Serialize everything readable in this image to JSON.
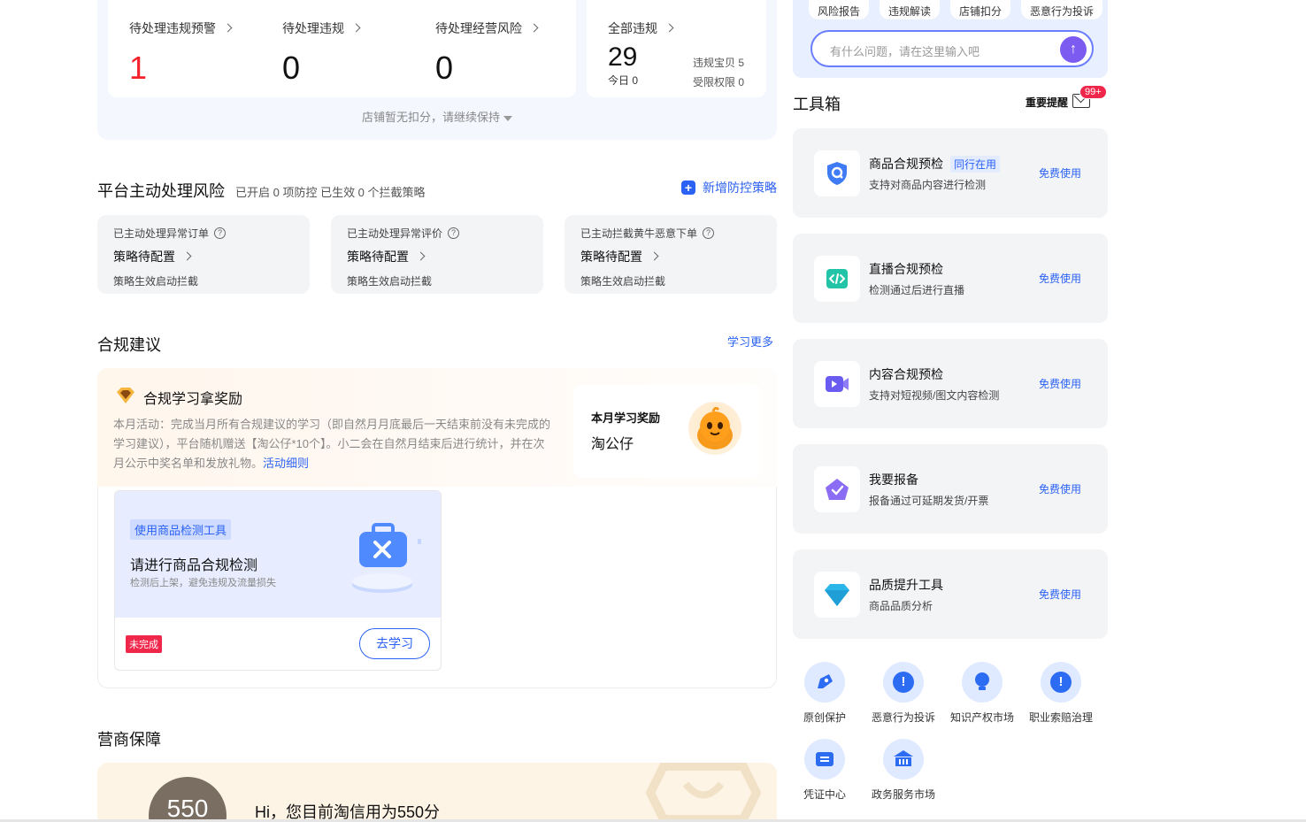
{
  "violations": {
    "items": [
      {
        "label": "待处理违规预警",
        "value": "1",
        "color": "#f5222d"
      },
      {
        "label": "待处理违规",
        "value": "0",
        "color": "#111111"
      },
      {
        "label": "待处理经营风险",
        "value": "0",
        "color": "#111111"
      }
    ],
    "all": {
      "label": "全部违规",
      "value": "29",
      "today": "今日 0",
      "baby": "违规宝贝 5",
      "restricted": "受限权限 0"
    },
    "deduct_note": "店铺暂无扣分，请继续保持"
  },
  "platform": {
    "title": "平台主动处理风险",
    "subtitle": "已开启 0 项防控 已生效 0 个拦截策略",
    "add_label": "新增防控策略",
    "cards": [
      {
        "label": "已主动处理异常订单",
        "status": "策略待配置",
        "note": "策略生效启动拦截"
      },
      {
        "label": "已主动处理异常评价",
        "status": "策略待配置",
        "note": "策略生效启动拦截"
      },
      {
        "label": "已主动拦截黄牛恶意下单",
        "status": "策略待配置",
        "note": "策略生效启动拦截"
      }
    ]
  },
  "compliance": {
    "title": "合规建议",
    "learn_more": "学习更多",
    "reward_title": "合规学习拿奖励",
    "reward_desc": "本月活动：完成当月所有合规建议的学习（即自然月月底最后一天结束前没有未完成的学习建议），平台随机赠送【淘公仔*10个】。小二会在自然月结束后进行统计，并在次月公示中奖名单和发放礼物。",
    "reward_link": "活动细则",
    "month_reward_label": "本月学习奖励",
    "month_reward_value": "淘公仔",
    "task": {
      "tag": "使用商品检测工具",
      "title": "请进行商品合规检测",
      "subtitle": "检测后上架，避免违规及流量损失",
      "status": "未完成",
      "button": "去学习"
    }
  },
  "business": {
    "title": "营商保障",
    "credit_score": "550",
    "credit_text": "Hi，您目前淘信用为550分"
  },
  "assistant": {
    "chips": [
      "风险报告",
      "违规解读",
      "店铺扣分",
      "恶意行为投诉"
    ],
    "input_placeholder": "有什么问题，请在这里输入吧"
  },
  "toolbox": {
    "title": "工具箱",
    "reminder": "重要提醒",
    "badge": "99+",
    "tools": [
      {
        "name": "商品合规预检",
        "tag": "同行在用",
        "desc": "支持对商品内容进行检测",
        "action": "免费使用",
        "icon": "shield-search-icon",
        "color": "#3f7bf5"
      },
      {
        "name": "直播合规预检",
        "tag": "",
        "desc": "检测通过后进行直播",
        "action": "免费使用",
        "icon": "code-icon",
        "color": "#21c4a6"
      },
      {
        "name": "内容合规预检",
        "tag": "",
        "desc": "支持对短视频/图文内容检测",
        "action": "免费使用",
        "icon": "video-icon",
        "color": "#6a5cf0"
      },
      {
        "name": "我要报备",
        "tag": "",
        "desc": "报备通过可延期发货/开票",
        "action": "免费使用",
        "icon": "report-house-icon",
        "color": "#8b6cf5"
      },
      {
        "name": "品质提升工具",
        "tag": "",
        "desc": "商品品质分析",
        "action": "免费使用",
        "icon": "diamond-icon",
        "color": "#2bb6ea"
      }
    ],
    "shortcuts": [
      {
        "label": "原创保护",
        "icon": "pen-icon"
      },
      {
        "label": "恶意行为投诉",
        "icon": "alert-icon"
      },
      {
        "label": "知识产权市场",
        "icon": "bulb-icon"
      },
      {
        "label": "职业索赔治理",
        "icon": "alert-icon"
      },
      {
        "label": "凭证中心",
        "icon": "voucher-icon"
      },
      {
        "label": "政务服务市场",
        "icon": "government-icon"
      }
    ]
  }
}
